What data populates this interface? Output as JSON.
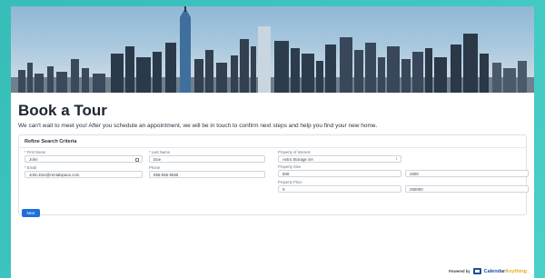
{
  "page": {
    "title": "Book a Tour",
    "intro": "We can't wait to meet you! After you schedule an appointment, we will be in touch to confirm next steps and help you find your new home."
  },
  "form": {
    "section_title": "Refine Search Criteria",
    "first_name": {
      "label": "* First Name",
      "value": "John"
    },
    "last_name": {
      "label": "* Last Name",
      "value": "Doe"
    },
    "email": {
      "label": "* Email",
      "value": "John.Doe@rentalspace.com"
    },
    "phone": {
      "label": "Phone",
      "value": "555-555-5555"
    },
    "property_interest": {
      "label": "Property of Interest",
      "value": "Astro Storage SA"
    },
    "property_size": {
      "label": "Property Size",
      "min": "500",
      "max": "2500"
    },
    "property_price": {
      "label": "Property Price",
      "min": "0",
      "max": "250000"
    },
    "next_label": "Next"
  },
  "footer": {
    "powered_by": "Powered by",
    "brand_part1": "Calendar",
    "brand_part2": "Anything"
  },
  "icons": {
    "calendar": "calendar-icon",
    "select": "chevron-updown-icon"
  },
  "colors": {
    "accent": "#1e6fd9",
    "background": "#3ec6c0",
    "brand_blue": "#1e4f9a",
    "brand_yellow": "#e0b020"
  }
}
